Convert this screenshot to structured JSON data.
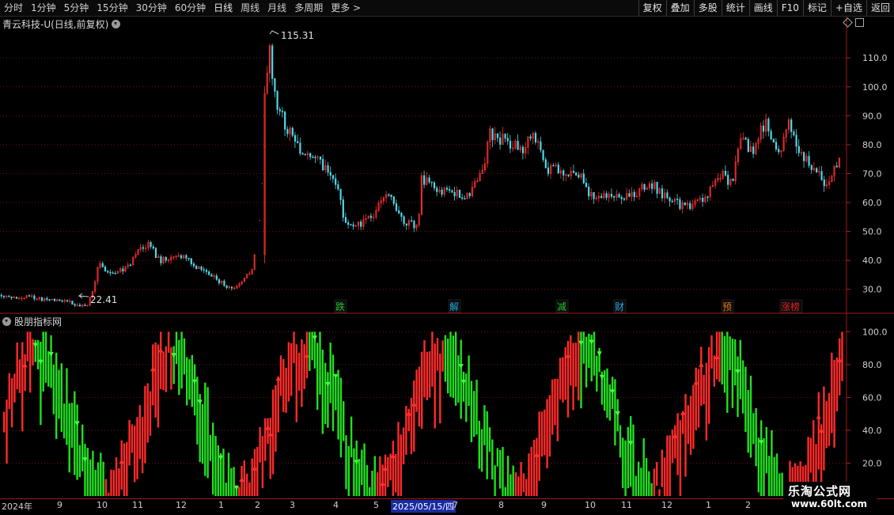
{
  "toolbar": {
    "periods": [
      "分时",
      "1分钟",
      "5分钟",
      "15分钟",
      "30分钟",
      "60分钟",
      "日线",
      "周线",
      "月线",
      "多周期",
      "更多 >"
    ],
    "active_period": "日线",
    "buttons": [
      "复权",
      "叠加",
      "多股",
      "统计",
      "画线",
      "F10",
      "标记",
      "+自选",
      "返回"
    ]
  },
  "main": {
    "title": "青云科技-U(日线,前复权)",
    "high_label": "115.31",
    "low_label": "22.41",
    "yaxis": [
      "110.0",
      "100.0",
      "90.0",
      "80.0",
      "70.0",
      "60.0",
      "50.0",
      "40.0",
      "30.0"
    ],
    "events": [
      {
        "text": "跌",
        "color": "#22c030"
      },
      {
        "text": "解",
        "color": "#20a8e0"
      },
      {
        "text": "减",
        "color": "#22c030"
      },
      {
        "text": "财",
        "color": "#20a8e0"
      },
      {
        "text": "预",
        "color": "#e07818"
      },
      {
        "text": "涨榜",
        "color": "#e02020"
      }
    ]
  },
  "indicator": {
    "title": "股朋指标网",
    "yaxis": [
      "100.0",
      "80.0",
      "60.0",
      "40.0",
      "20.0"
    ]
  },
  "dates": [
    "2024年",
    "9",
    "10",
    "11",
    "12",
    "1",
    "2",
    "3",
    "4",
    "5",
    "2025/05/15/四",
    "7",
    "8",
    "9",
    "10",
    "11",
    "12",
    "1",
    "2"
  ],
  "watermark": {
    "line1": "乐淘公式网",
    "line2": "www.60lt.com"
  },
  "colors": {
    "up": "#ff3030",
    "down": "#50d8e8",
    "up_bar": "#ff2a2a",
    "down_bar": "#20e020",
    "grid": "#7a0f0f"
  },
  "chart_data": {
    "type": "candlestick",
    "price_range": [
      22.41,
      115.31
    ],
    "ylim_main": [
      22,
      121
    ],
    "ylim_indicator": [
      0,
      105
    ]
  }
}
